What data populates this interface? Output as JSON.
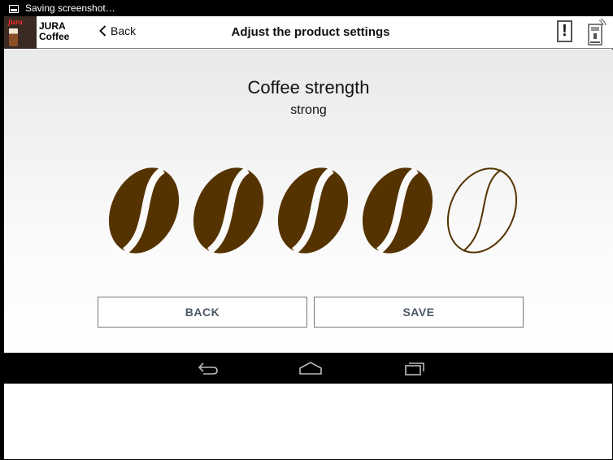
{
  "status_bar": {
    "notification_text": "Saving screenshot…",
    "icon": "image-icon"
  },
  "action_bar": {
    "logo_brand": "jura",
    "app_name_line1": "JURA",
    "app_name_line2": "Coffee",
    "back_label": "Back",
    "title": "Adjust the product settings",
    "alert_icon": "exclamation-icon",
    "alert_text": "!",
    "machine_icon": "coffee-machine-wifi-icon"
  },
  "setting": {
    "label": "Coffee strength",
    "value_text": "strong",
    "level_filled": 4,
    "level_max": 5
  },
  "buttons": {
    "back_label": "BACK",
    "save_label": "SAVE"
  },
  "nav_bar": {
    "icons": [
      "back-icon",
      "home-icon",
      "recent-apps-icon"
    ]
  },
  "colors": {
    "bean_fill": "#553300",
    "button_text": "#4c5766",
    "bar_black": "#000000"
  }
}
